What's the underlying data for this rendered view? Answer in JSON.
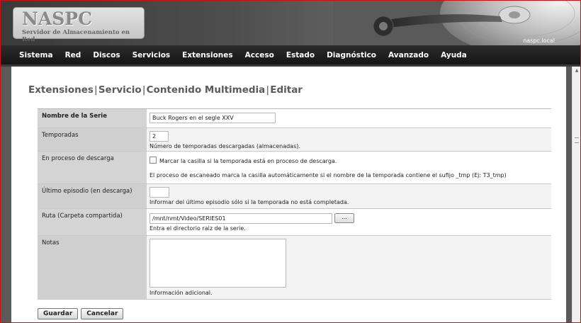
{
  "header": {
    "logo_title": "NASPC",
    "logo_subtitle": "Servidor de Almacenamiento en Red",
    "hostname": "naspc.local"
  },
  "menu": [
    "Sistema",
    "Red",
    "Discos",
    "Servicios",
    "Extensiones",
    "Acceso",
    "Estado",
    "Diagnóstico",
    "Avanzado",
    "Ayuda"
  ],
  "breadcrumb": [
    "Extensiones",
    "Servicio",
    "Contenido Multimedia",
    "Editar"
  ],
  "breadcrumb_sep": "|",
  "form": {
    "serie_label": "Nombre de la Serie",
    "serie_value": "Buck Rogers en el segle XXV",
    "temporadas_label": "Temporadas",
    "temporadas_value": "2",
    "temporadas_hint": "Número de temporadas descargadas (almacenadas).",
    "descarga_label": "En proceso de descarga",
    "descarga_checkbox_label": "Marcar la casilla si la temporada está en proceso de descarga.",
    "descarga_hint": "El proceso de escaneado marca la casilla automáticamente si el nombre de la temporada contiene el sufijo _tmp (Ej: T3_tmp)",
    "ultimo_label": "Último episodio (en descarga)",
    "ultimo_value": "",
    "ultimo_hint": "Informar del último episodio sólo si la temporada no está completada.",
    "ruta_label": "Ruta (Carpeta compartida)",
    "ruta_value": "/mnt/nmt/Video/SERIES01",
    "ruta_browse": "...",
    "ruta_hint": "Entra el directorio raiz de la serie.",
    "notas_label": "Notas",
    "notas_value": "",
    "notas_hint": "Información adicional."
  },
  "actions": {
    "save_label": "Guardar",
    "cancel_label": "Cancelar"
  },
  "colors": {
    "menubar": "#1c1c1c",
    "label_bg": "#d4d4d4",
    "frame": "#d01010"
  }
}
